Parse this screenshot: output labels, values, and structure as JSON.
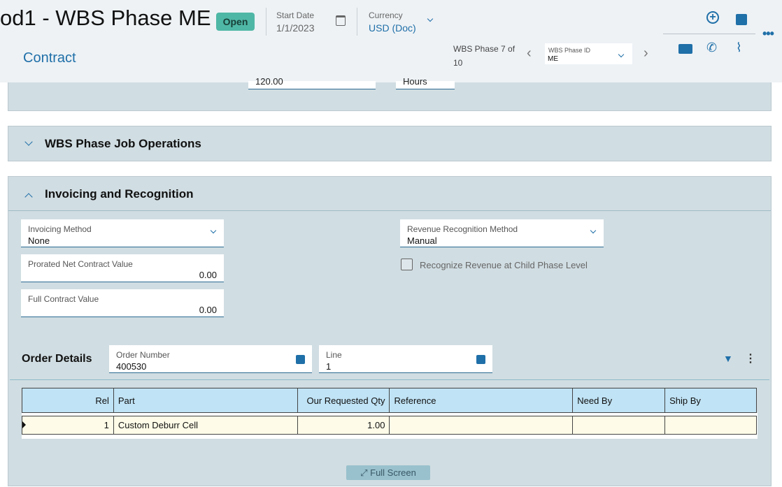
{
  "header": {
    "title": "od1 - WBS Phase ME",
    "status": "Open",
    "start_date_label": "Start Date",
    "start_date": "1/1/2023",
    "currency_label": "Currency",
    "currency": "USD (Doc)",
    "tab": "Contract",
    "nav_text": "WBS Phase 7 of 10",
    "phase_id_label": "WBS Phase ID",
    "phase_id": "ME"
  },
  "partial_fields": {
    "qty": "120.00",
    "unit": "Hours"
  },
  "sections": {
    "job_ops": "WBS Phase Job Operations",
    "invoicing": "Invoicing and Recognition"
  },
  "invoicing": {
    "method_label": "Invoicing Method",
    "method": "None",
    "prorated_label": "Prorated Net Contract Value",
    "prorated": "0.00",
    "full_label": "Full Contract Value",
    "full": "0.00",
    "rev_label": "Revenue Recognition Method",
    "rev": "Manual",
    "child_label": "Recognize Revenue at Child Phase Level",
    "child_checked": false
  },
  "order": {
    "title": "Order Details",
    "number_label": "Order Number",
    "number": "400530",
    "line_label": "Line",
    "line": "1"
  },
  "grid": {
    "columns": [
      "Rel",
      "Part",
      "Our Requested Qty",
      "Reference",
      "Need By",
      "Ship By"
    ],
    "rows": [
      [
        "1",
        "Custom Deburr Cell",
        "1.00",
        "",
        "",
        ""
      ]
    ]
  },
  "full_screen": "Full Screen",
  "colors": {
    "accent": "#1f6fa8",
    "badge": "#4fb7a6",
    "panel": "#d0dde2",
    "grid_header": "#c0e3f5",
    "grid_row": "#fefce8"
  }
}
